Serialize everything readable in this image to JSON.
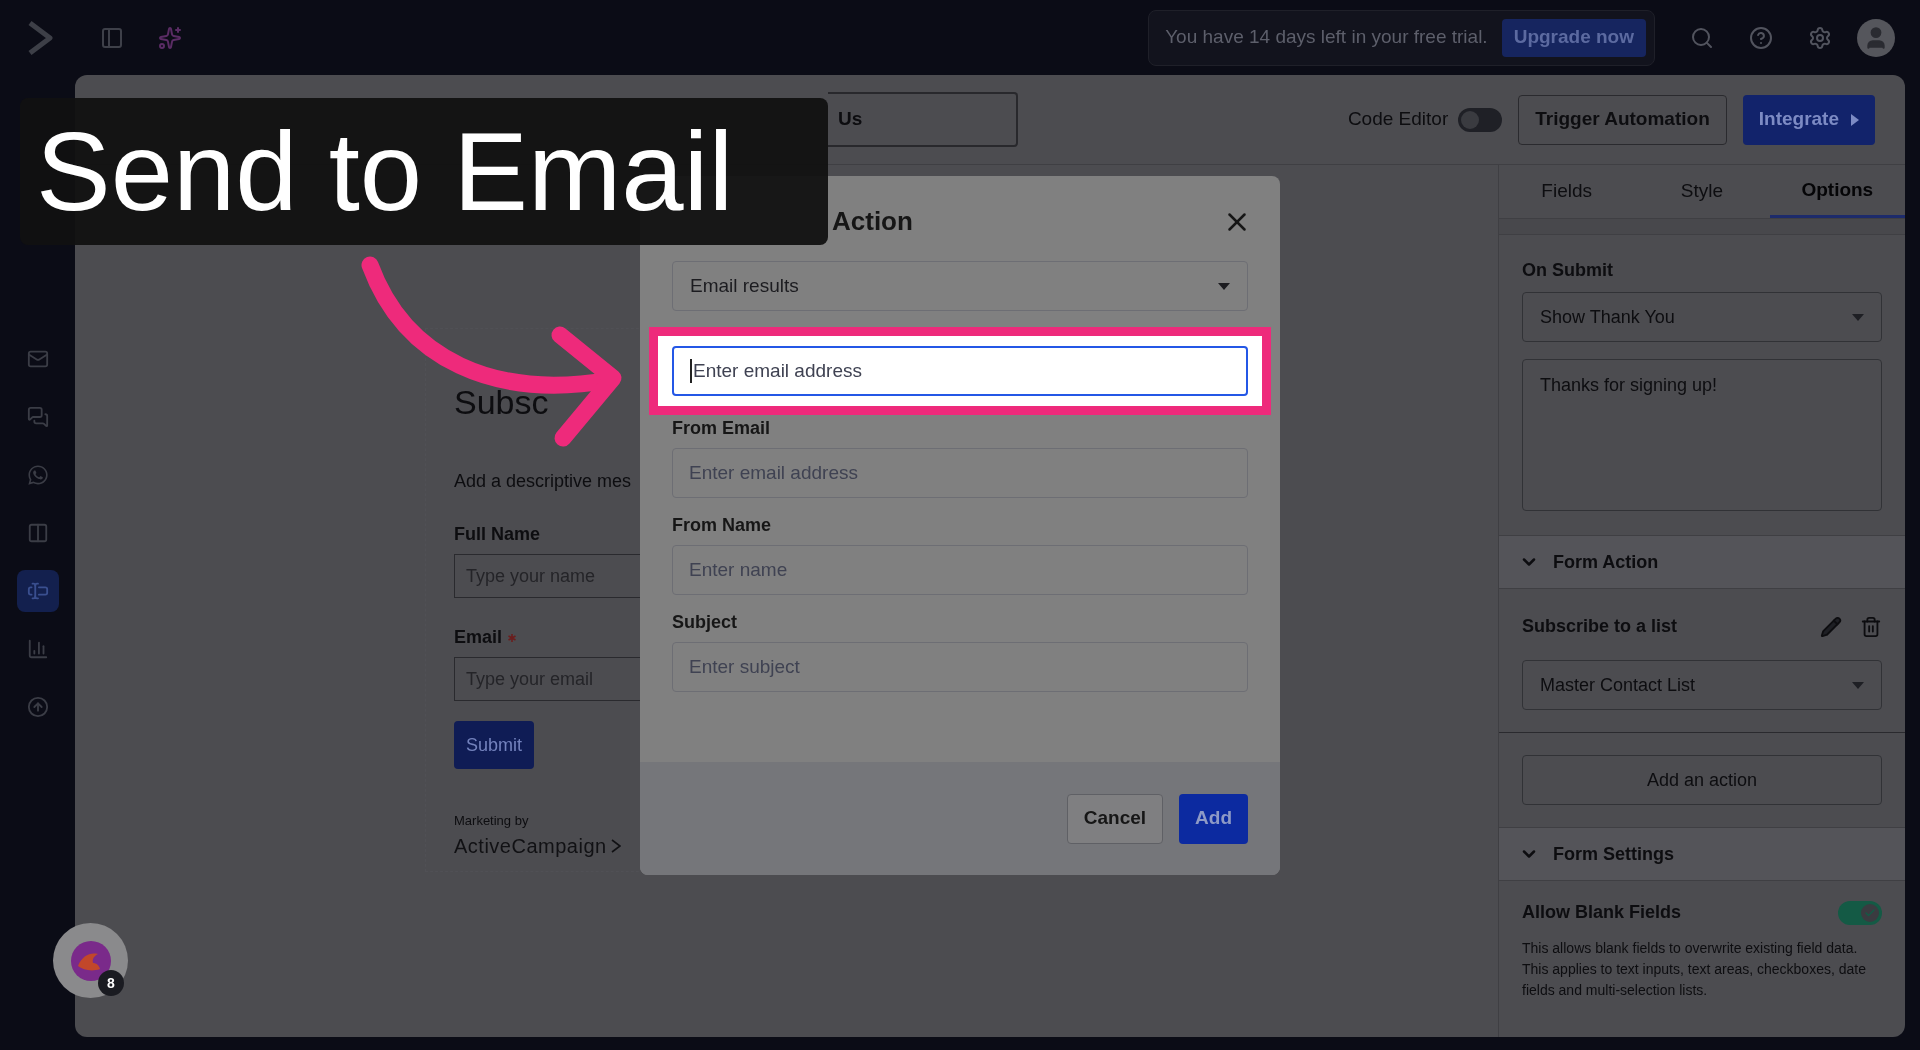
{
  "caption": "Send to Email",
  "topbar": {
    "trial_text": "You have 14 days left in your free trial.",
    "upgrade_button": "Upgrade now"
  },
  "sidebar": {
    "items": [
      {
        "selected": false
      },
      {
        "selected": false
      },
      {
        "selected": false
      },
      {
        "selected": false
      },
      {
        "selected": true
      },
      {
        "selected": false
      },
      {
        "selected": false
      }
    ]
  },
  "toolbar": {
    "form_title": "Us",
    "code_editor": {
      "label": "Code Editor",
      "on": false
    },
    "trigger_button": "Trigger Automation",
    "integrate_button": "Integrate"
  },
  "form_preview": {
    "heading": "Subsc",
    "description": "Add a descriptive mes",
    "fields": [
      {
        "label": "Full Name",
        "placeholder": "Type your name",
        "required": false
      },
      {
        "label": "Email",
        "placeholder": "Type your email",
        "required": true
      }
    ],
    "submit_button": "Submit",
    "footer_small": "Marketing by",
    "footer_brand": "ActiveCampaign"
  },
  "modal": {
    "title": "Action",
    "action_select": "Email results",
    "fields": [
      {
        "placeholder": "Enter email address",
        "focused": true,
        "highlighted": true
      },
      {
        "label": "From Email",
        "placeholder": "Enter email address",
        "focused": false,
        "highlighted": false
      },
      {
        "label": "From Name",
        "placeholder": "Enter name",
        "focused": false,
        "highlighted": false
      },
      {
        "label": "Subject",
        "placeholder": "Enter subject",
        "focused": false,
        "highlighted": false
      }
    ],
    "cancel_button": "Cancel",
    "add_button": "Add"
  },
  "right_panel": {
    "tabs": [
      {
        "label": "Fields",
        "selected": false
      },
      {
        "label": "Style",
        "selected": false
      },
      {
        "label": "Options",
        "selected": true
      }
    ],
    "on_submit": {
      "label": "On Submit",
      "value": "Show Thank You",
      "message": "Thanks for signing up!"
    },
    "form_action": {
      "title": "Form Action",
      "expanded": true,
      "action_label": "Subscribe to a list",
      "list_value": "Master Contact List",
      "add_button": "Add an action"
    },
    "form_settings": {
      "title": "Form Settings",
      "expanded": true,
      "allow_blank": {
        "label": "Allow Blank Fields",
        "on": true,
        "description": "This allows blank fields to overwrite existing field data. This applies to text inputs, text areas, checkboxes, date fields and multi-selection lists."
      }
    }
  },
  "chat_bubble": {
    "badge": "8"
  }
}
